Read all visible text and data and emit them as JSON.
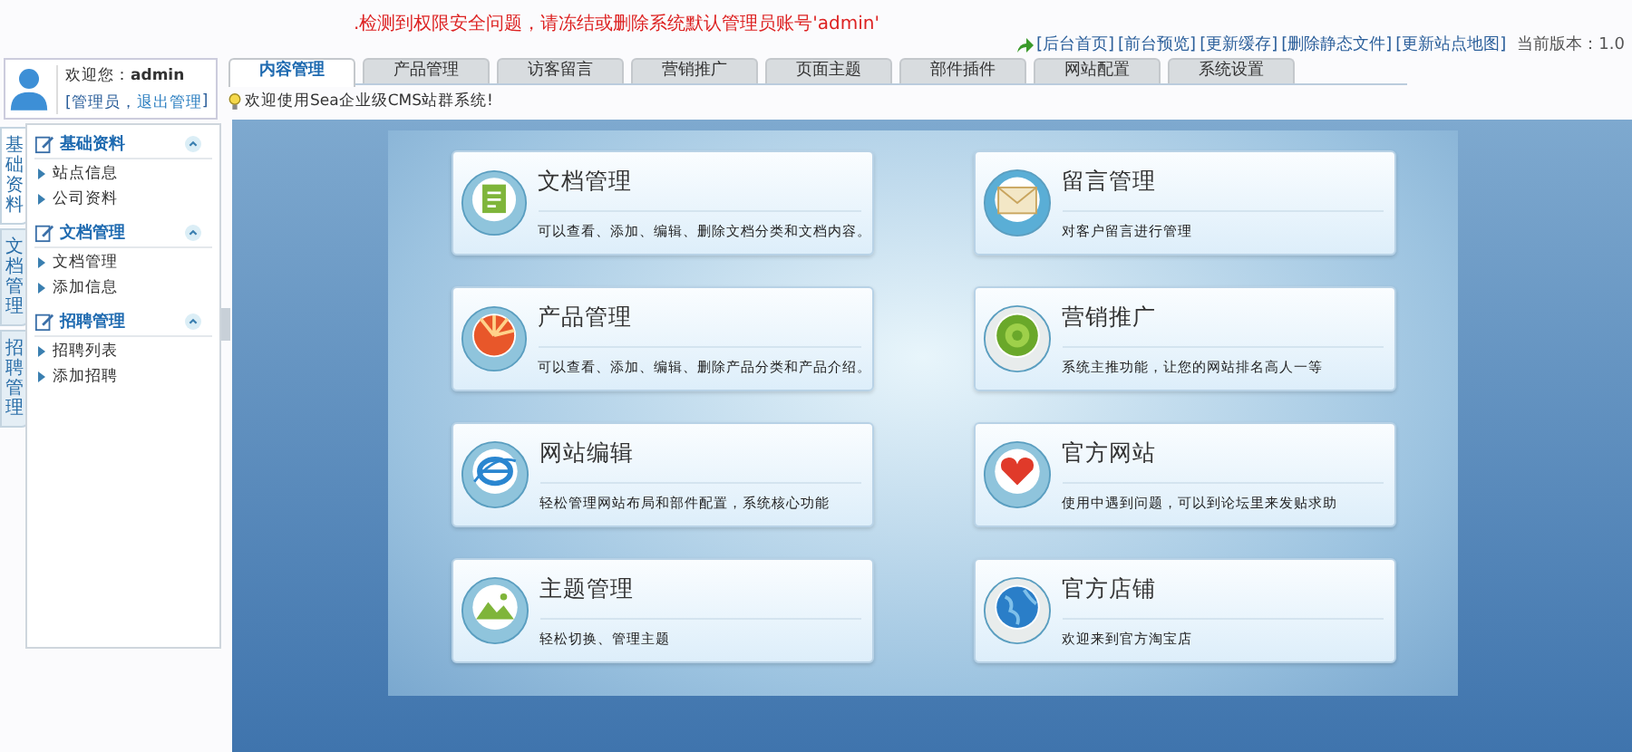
{
  "notice": ".检测到权限安全问题，请冻结或删除系统默认管理员账号'admin'",
  "top_links": [
    "[后台首页]",
    "[前台预览]",
    "[更新缓存]",
    "[删除静态文件]",
    "[更新站点地图]"
  ],
  "version": "当前版本：1.0",
  "user": {
    "greeting": "欢迎您：",
    "name": "admin",
    "role": "[管理员，",
    "logout": "退出管理",
    "suffix": " ]"
  },
  "tabs": [
    {
      "label": "内容管理",
      "selected": true
    },
    {
      "label": "产品管理",
      "selected": false
    },
    {
      "label": "访客留言",
      "selected": false
    },
    {
      "label": "营销推广",
      "selected": false
    },
    {
      "label": "页面主题",
      "selected": false
    },
    {
      "label": "部件插件",
      "selected": false
    },
    {
      "label": "网站配置",
      "selected": false
    },
    {
      "label": "系统设置",
      "selected": false
    }
  ],
  "welcome": "欢迎使用Sea企业级CMS站群系统!",
  "side_tabs": [
    {
      "label": "基础资料",
      "selected": true
    },
    {
      "label": "文档管理",
      "selected": false
    },
    {
      "label": "招聘管理",
      "selected": false
    }
  ],
  "sections": [
    {
      "title": "基础资料",
      "expanded": true,
      "items": [
        "站点信息",
        "公司资料"
      ]
    },
    {
      "title": "文档管理",
      "expanded": true,
      "items": [
        "文档管理",
        "添加信息"
      ]
    },
    {
      "title": "招聘管理",
      "expanded": true,
      "items": [
        "招聘列表",
        "添加招聘"
      ]
    }
  ],
  "cards": [
    {
      "title": "文档管理",
      "desc": "可以查看、添加、编辑、删除文档分类和文档内容。"
    },
    {
      "title": "留言管理",
      "desc": "对客户留言进行管理"
    },
    {
      "title": "产品管理",
      "desc": "可以查看、添加、编辑、删除产品分类和产品介绍。"
    },
    {
      "title": "营销推广",
      "desc": "系统主推功能，让您的网站排名高人一等"
    },
    {
      "title": "网站编辑",
      "desc": "轻松管理网站布局和部件配置，系统核心功能"
    },
    {
      "title": "官方网站",
      "desc": "使用中遇到问题，可以到论坛里来发贴求助"
    },
    {
      "title": "主题管理",
      "desc": "轻松切换、管理主题"
    },
    {
      "title": "官方店铺",
      "desc": "欢迎来到官方淘宝店"
    }
  ]
}
